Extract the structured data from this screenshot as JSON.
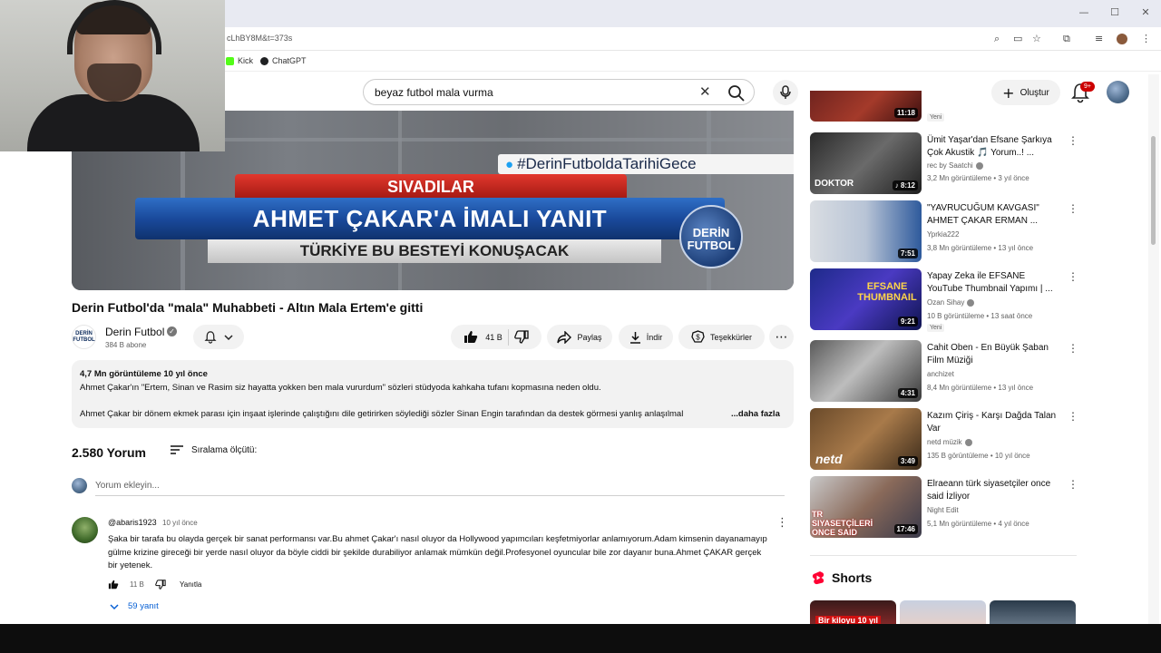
{
  "browser": {
    "url": "cLhBY8M&t=373s",
    "bookmarks": [
      {
        "label": "Kick",
        "color": "#53fc18"
      },
      {
        "label": "ChatGPT",
        "color": "#202123"
      }
    ],
    "window_controls": {
      "minimize": "—",
      "maximize": "☐",
      "close": "✕"
    }
  },
  "header": {
    "search_query": "beyaz futbol mala vurma",
    "create_label": "Oluştur",
    "notif_badge": "9+"
  },
  "player": {
    "hashtag": "#DerinFutboldaTarihiGece",
    "red_banner": "SIVADILAR",
    "blue_banner": "AHMET ÇAKAR'A İMALI YANIT",
    "grey_banner": "TÜRKİYE BU BESTEYİ KONUŞACAK",
    "logo_text": "DERİN FUTBOL"
  },
  "video": {
    "title": "Derin Futbol'da \"mala\" Muhabbeti - Altın Mala Ertem'e gitti",
    "channel": "Derin Futbol",
    "channel_logo": "DERİN FUTBOL",
    "subscribers": "384 B abone",
    "likes": "41 B",
    "share_label": "Paylaş",
    "download_label": "İndir",
    "thanks_label": "Teşekkürler"
  },
  "description": {
    "stats": "4,7 Mn görüntüleme  10 yıl önce",
    "line1": "Ahmet Çakar'ın \"Ertem, Sinan ve Rasim siz hayatta yokken ben mala vururdum\" sözleri stüdyoda kahkaha tufanı kopmasına neden oldu.",
    "line2": "Ahmet Çakar bir dönem ekmek parası için inşaat işlerinde çalıştığını dile getirirken söylediği sözler Sinan Engin tarafından da destek görmesi yanlış anlaşılmal",
    "more": "...daha fazla"
  },
  "comments": {
    "count": "2.580 Yorum",
    "sort_label": "Sıralama ölçütü:",
    "input_placeholder": "Yorum ekleyin...",
    "items": [
      {
        "author": "@abaris1923",
        "time": "10 yıl önce",
        "text": "Şaka bir tarafa bu olayda gerçek bir sanat performansı var.Bu ahmet Çakar'ı nasıl oluyor da Hollywood yapımcıları keşfetmiyorlar anlamıyorum.Adam kimsenin dayanamayıp gülme krizine gireceği bir yerde nasıl oluyor da böyle ciddi bir şekilde durabiliyor anlamak mümkün değil.Profesyonel oyuncular bile zor dayanır buna.Ahmet ÇAKAR gerçek bir yetenek.",
        "likes": "11 B",
        "reply_label": "Yanıtla",
        "replies": "59 yanıt"
      }
    ]
  },
  "sidebar": {
    "top_partial": {
      "duration": "11:18",
      "badge": "Yeni"
    },
    "items": [
      {
        "title": "Ümit Yaşar'dan Efsane Şarkıya Çok Akustik 🎵 Yorum..! ...",
        "channel": "rec by Saatchi",
        "verified": true,
        "meta": "3,2 Mn görüntüleme • 3 yıl önce",
        "duration": "8:12",
        "badge": "",
        "thumb_text": "DOKTOR"
      },
      {
        "title": "\"YAVRUCUĞUM KAVGASI\" AHMET ÇAKAR ERMAN ...",
        "channel": "Yprkia222",
        "verified": false,
        "meta": "3,8 Mn görüntüleme • 13 yıl önce",
        "duration": "7:51",
        "badge": "",
        "thumb_text": ""
      },
      {
        "title": "Yapay Zeka ile EFSANE YouTube Thumbnail Yapımı | ...",
        "channel": "Ozan Sihay",
        "verified": true,
        "meta": "10 B görüntüleme • 13 saat önce",
        "duration": "9:21",
        "badge": "Yeni",
        "thumb_text": "EFSANE THUMBNAIL"
      },
      {
        "title": "Cahit Oben - En Büyük Şaban Film Müziği",
        "channel": "anchizet",
        "verified": false,
        "meta": "8,4 Mn görüntüleme • 13 yıl önce",
        "duration": "4:31",
        "badge": "",
        "thumb_text": ""
      },
      {
        "title": "Kazım Çiriş - Karşı Dağda Talan Var",
        "channel": "netd müzik",
        "verified": true,
        "meta": "135 B görüntüleme • 10 yıl önce",
        "duration": "3:49",
        "badge": "",
        "thumb_text": "netd"
      },
      {
        "title": "Elraeann türk siyasetçiler once said İzliyor",
        "channel": "Night Edit",
        "verified": false,
        "meta": "5,1 Mn görüntüleme • 4 yıl önce",
        "duration": "17:46",
        "badge": "",
        "thumb_text": "TR SIYASETÇİLERİ ONCE SAID"
      }
    ],
    "shorts_label": "Shorts",
    "shorts_first_text": "Bir kiloyu 10 yıl"
  },
  "colors": {
    "accent_red": "#ff0000",
    "link_blue": "#065fd4",
    "pill_bg": "#f2f2f2"
  }
}
